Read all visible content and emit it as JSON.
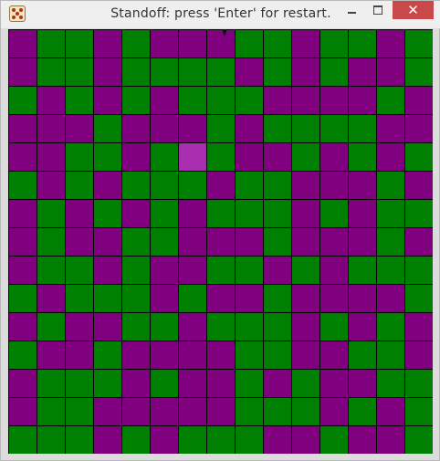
{
  "window": {
    "title": "Standoff: press 'Enter' for restart.",
    "icon": "dice-icon"
  },
  "controls": {
    "minimize": "minimize-icon",
    "maximize": "maximize-icon",
    "close": "✕"
  },
  "colors": {
    "G": "#008000",
    "P": "#800080",
    "H": "#aa2fb0"
  },
  "board": {
    "rows": 15,
    "cols": 15,
    "grid": [
      "PGGPGPPPGGPGGPG",
      "PGGPGGGGPGPGPPG",
      "GPGPGPGGGPPPPGP",
      "PPPGPPPGPGGGGPP",
      "PPGGPGHGPPGPGPG",
      "GPGPGGGPGGPPPGP",
      "PGPGPGPGGGPGPGG",
      "PGPPGGPPPGPPPGP",
      "PGGPGPPGGPGPGGG",
      "GPGGGPGPPGPPPPG",
      "PGPPGGPGGGPGPGP",
      "GPPGPPPPGGPPGGP",
      "PGGGPGPPGPGPPGG",
      "PGGPPPPPGGGPGPG",
      "GGGPGPGGGPPGPPG"
    ]
  }
}
